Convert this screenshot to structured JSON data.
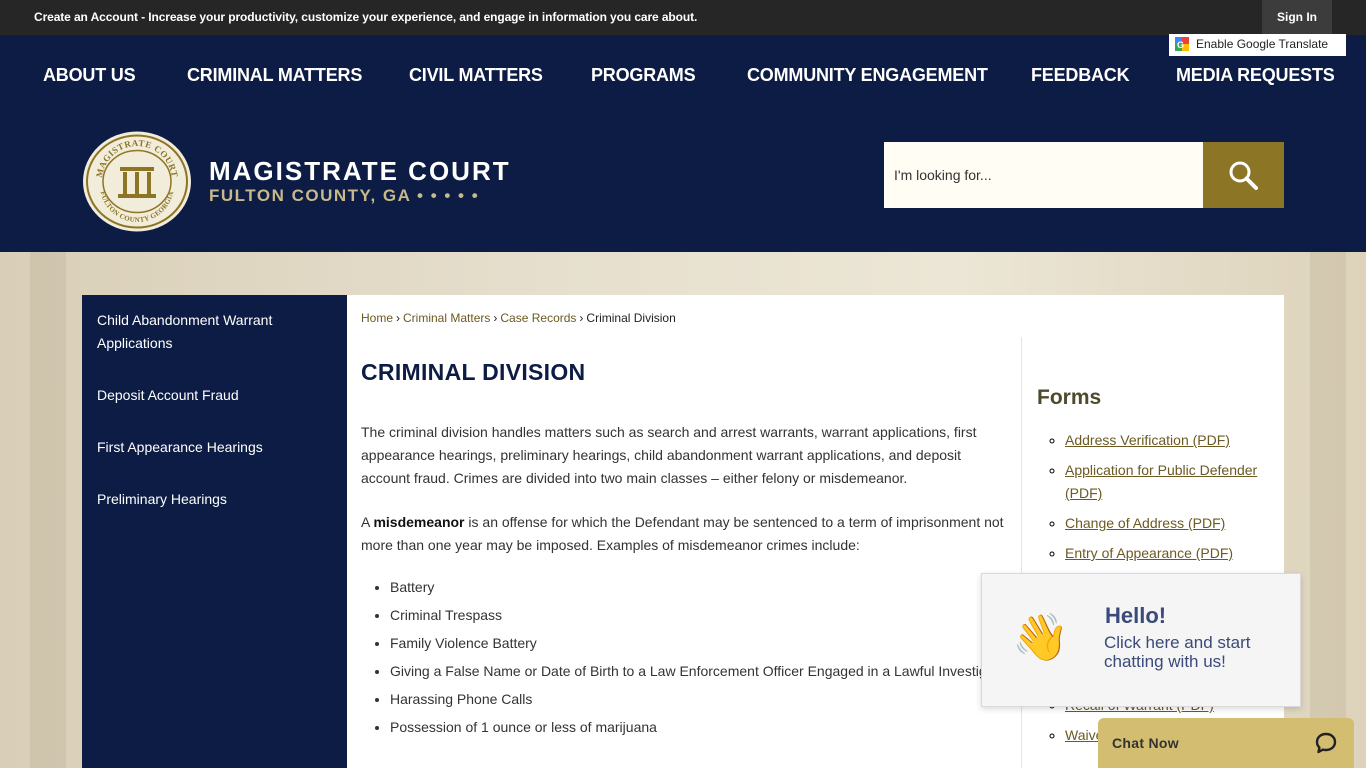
{
  "topbar": {
    "create_account": "Create an Account",
    "tagline": " - Increase your productivity, customize your experience, and engage in information you care about.",
    "sign_in": "Sign In"
  },
  "translate": {
    "label": "Enable Google Translate"
  },
  "nav": [
    "ABOUT US",
    "CRIMINAL MATTERS",
    "CIVIL MATTERS",
    "PROGRAMS",
    "COMMUNITY ENGAGEMENT",
    "FEEDBACK",
    "MEDIA REQUESTS"
  ],
  "site": {
    "title": "MAGISTRATE COURT",
    "subtitle": "FULTON COUNTY, GA • • • • •",
    "seal_top": "MAGISTRATE COURT",
    "seal_bottom": "FULTON COUNTY GEORGIA"
  },
  "search": {
    "placeholder": "I'm looking for..."
  },
  "sidenav": [
    "Child Abandonment Warrant Applications",
    "Deposit Account Fraud",
    "First Appearance Hearings",
    "Preliminary Hearings"
  ],
  "breadcrumb": {
    "home": "Home",
    "criminal": "Criminal Matters",
    "records": "Case Records",
    "current": "Criminal Division",
    "separator": "›"
  },
  "page": {
    "title": "CRIMINAL DIVISION",
    "intro": "The criminal division handles matters such as search and arrest warrants, warrant applications, first appearance hearings, preliminary hearings, child abandonment warrant applications, and deposit account fraud. Crimes are divided into two main classes – either felony or misdemeanor.",
    "misd_prefix": "A ",
    "misd_term": "misdemeanor",
    "misd_rest": " is an offense for which the Defendant may be sentenced to a term of imprisonment not more than one year may be imposed. Examples of misdemeanor crimes include:",
    "examples": [
      "Battery",
      "Criminal Trespass",
      "Family Violence Battery",
      "Giving a False Name or Date of Birth to a Law Enforcement Officer Engaged in a Lawful Investigation",
      "Harassing Phone Calls",
      "Possession of 1 ounce or less of marijuana"
    ]
  },
  "forms": {
    "title": "Forms",
    "items": [
      "Address Verification (PDF)",
      "Application for Public Defender (PDF)",
      "Change of Address (PDF)",
      "Entry of Appearance (PDF)",
      "Recall of Warrant (PDF)",
      "Waiver"
    ]
  },
  "chat": {
    "wave": "👋",
    "hello": "Hello!",
    "prompt": "Click here and start chatting with us!",
    "bar_label": "Chat Now"
  },
  "colors": {
    "navy": "#0d1c44",
    "gold": "#8c7525",
    "link_gold": "#6b5a21",
    "chat_bar": "#d2bd70"
  }
}
